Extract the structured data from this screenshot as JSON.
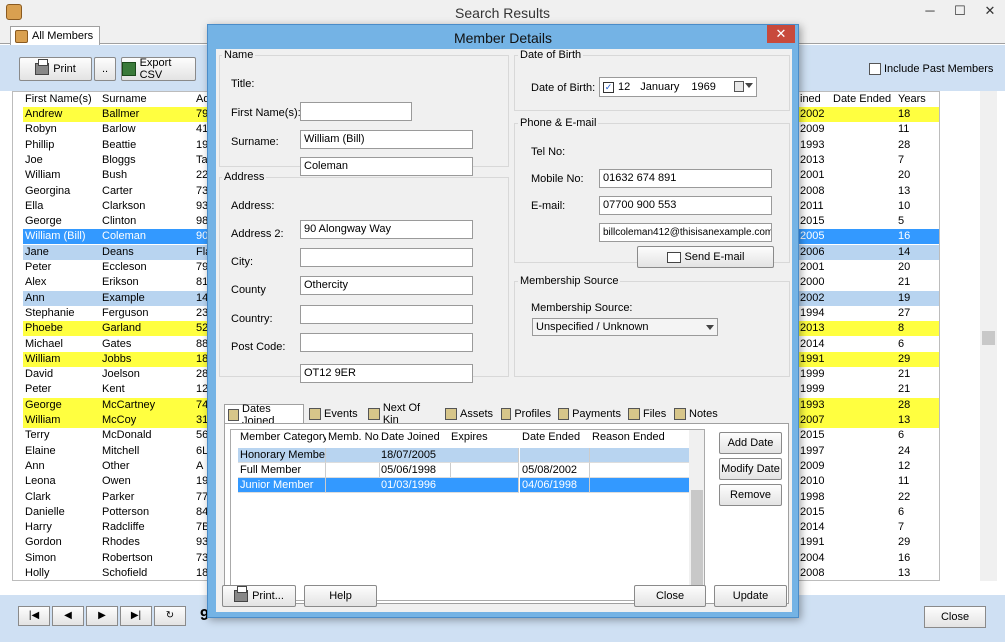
{
  "window": {
    "title": "Search Results",
    "minimize": "─",
    "maximize": "☐",
    "close": "✕"
  },
  "main_tab": {
    "label": "All Members"
  },
  "toolbar": {
    "print_label": "Print",
    "more_label": "..",
    "export_label": "Export CSV",
    "include_past_label": "Include Past Members"
  },
  "grid": {
    "headers": {
      "first": "First Name(s)",
      "surname": "Surname",
      "address": "Ad",
      "joined": "ined",
      "ended": "Date Ended",
      "years": "Years"
    },
    "rows": [
      {
        "first": "Andrew",
        "surname": "Ballmer",
        "address": "79",
        "joined": "2002",
        "ended": "",
        "years": "18",
        "style": "yellow"
      },
      {
        "first": "Robyn",
        "surname": "Barlow",
        "address": "41",
        "joined": "2009",
        "ended": "",
        "years": "11",
        "style": ""
      },
      {
        "first": "Phillip",
        "surname": "Beattie",
        "address": "19",
        "joined": "1993",
        "ended": "",
        "years": "28",
        "style": ""
      },
      {
        "first": "Joe",
        "surname": "Bloggs",
        "address": "Ta",
        "joined": "2013",
        "ended": "",
        "years": "7",
        "style": ""
      },
      {
        "first": "William",
        "surname": "Bush",
        "address": "22",
        "joined": "2001",
        "ended": "",
        "years": "20",
        "style": ""
      },
      {
        "first": "Georgina",
        "surname": "Carter",
        "address": "73",
        "joined": "2008",
        "ended": "",
        "years": "13",
        "style": ""
      },
      {
        "first": "Ella",
        "surname": "Clarkson",
        "address": "93",
        "joined": "2011",
        "ended": "",
        "years": "10",
        "style": ""
      },
      {
        "first": "George",
        "surname": "Clinton",
        "address": "98",
        "joined": "2015",
        "ended": "",
        "years": "5",
        "style": ""
      },
      {
        "first": "William (Bill)",
        "surname": "Coleman",
        "address": "90",
        "joined": "2005",
        "ended": "",
        "years": "16",
        "style": "selected"
      },
      {
        "first": "Jane",
        "surname": "Deans",
        "address": "Fla",
        "joined": "2006",
        "ended": "",
        "years": "14",
        "style": "alt"
      },
      {
        "first": "Peter",
        "surname": "Eccleson",
        "address": "79",
        "joined": "2001",
        "ended": "",
        "years": "20",
        "style": ""
      },
      {
        "first": "Alex",
        "surname": "Erikson",
        "address": "81",
        "joined": "2000",
        "ended": "",
        "years": "21",
        "style": ""
      },
      {
        "first": "Ann",
        "surname": "Example",
        "address": "14",
        "joined": "2002",
        "ended": "",
        "years": "19",
        "style": "alt"
      },
      {
        "first": "Stephanie",
        "surname": "Ferguson",
        "address": "23",
        "joined": "1994",
        "ended": "",
        "years": "27",
        "style": ""
      },
      {
        "first": "Phoebe",
        "surname": "Garland",
        "address": "52",
        "joined": "2013",
        "ended": "",
        "years": "8",
        "style": "yellow"
      },
      {
        "first": "Michael",
        "surname": "Gates",
        "address": "88",
        "joined": "2014",
        "ended": "",
        "years": "6",
        "style": ""
      },
      {
        "first": "William",
        "surname": "Jobbs",
        "address": "18",
        "joined": "1991",
        "ended": "",
        "years": "29",
        "style": "yellow"
      },
      {
        "first": "David",
        "surname": "Joelson",
        "address": "28",
        "joined": "1999",
        "ended": "",
        "years": "21",
        "style": ""
      },
      {
        "first": "Peter",
        "surname": "Kent",
        "address": "12",
        "joined": "1999",
        "ended": "",
        "years": "21",
        "style": ""
      },
      {
        "first": "George",
        "surname": "McCartney",
        "address": "74",
        "joined": "1993",
        "ended": "",
        "years": "28",
        "style": "yellow"
      },
      {
        "first": "William",
        "surname": "McCoy",
        "address": "31",
        "joined": "2007",
        "ended": "",
        "years": "13",
        "style": "yellow"
      },
      {
        "first": "Terry",
        "surname": "McDonald",
        "address": "56",
        "joined": "2015",
        "ended": "",
        "years": "6",
        "style": ""
      },
      {
        "first": "Elaine",
        "surname": "Mitchell",
        "address": "6L",
        "joined": "1997",
        "ended": "",
        "years": "24",
        "style": ""
      },
      {
        "first": "Ann",
        "surname": "Other",
        "address": "A",
        "joined": "2009",
        "ended": "",
        "years": "12",
        "style": ""
      },
      {
        "first": "Leona",
        "surname": "Owen",
        "address": "19",
        "joined": "2010",
        "ended": "",
        "years": "11",
        "style": ""
      },
      {
        "first": "Clark",
        "surname": "Parker",
        "address": "77",
        "joined": "1998",
        "ended": "",
        "years": "22",
        "style": ""
      },
      {
        "first": "Danielle",
        "surname": "Potterson",
        "address": "84",
        "joined": "2015",
        "ended": "",
        "years": "6",
        "style": ""
      },
      {
        "first": "Harry",
        "surname": "Radcliffe",
        "address": "7B",
        "joined": "2014",
        "ended": "",
        "years": "7",
        "style": ""
      },
      {
        "first": "Gordon",
        "surname": "Rhodes",
        "address": "93",
        "joined": "1991",
        "ended": "",
        "years": "29",
        "style": ""
      },
      {
        "first": "Simon",
        "surname": "Robertson",
        "address": "73",
        "joined": "2004",
        "ended": "",
        "years": "16",
        "style": ""
      },
      {
        "first": "Holly",
        "surname": "Schofield",
        "address": "18",
        "joined": "2008",
        "ended": "",
        "years": "13",
        "style": ""
      }
    ]
  },
  "navigation": {
    "first": "|◀",
    "prev": "◀",
    "next": "▶",
    "last": "▶|",
    "refresh": "↻"
  },
  "count_text": "9",
  "close_main_label": "Close",
  "dialog": {
    "title": "Member Details",
    "close": "✕",
    "name_group": "Name",
    "title_label": "Title:",
    "title_value": "",
    "first_label": "First Name(s):",
    "first_value": "William (Bill)",
    "surname_label": "Surname:",
    "surname_value": "Coleman",
    "address_group": "Address",
    "address_label": "Address:",
    "address_value": "90 Alongway Way",
    "address2_label": "Address 2:",
    "address2_value": "",
    "city_label": "City:",
    "city_value": "Othercity",
    "county_label": "County",
    "county_value": "",
    "country_label": "Country:",
    "country_value": "",
    "postcode_label": "Post Code:",
    "postcode_value": "OT12 9ER",
    "dob_group": "Date of Birth",
    "dob_label": "Date of Birth:",
    "dob_day": "12",
    "dob_month": "January",
    "dob_year": "1969",
    "phone_group": "Phone & E-mail",
    "tel_label": "Tel No:",
    "tel_value": "01632 674 891",
    "mobile_label": "Mobile No:",
    "mobile_value": "07700 900 553",
    "email_label": "E-mail:",
    "email_value": "billcoleman412@thisisanexample.com",
    "send_email_label": "Send E-mail",
    "source_group": "Membership Source",
    "source_label": "Membership Source:",
    "source_value": "Unspecified / Unknown",
    "tabs": [
      "Dates Joined",
      "Events",
      "Next Of Kin",
      "Assets",
      "Profiles",
      "Payments",
      "Files",
      "Notes"
    ],
    "dates_headers": {
      "category": "Member Category",
      "memb": "Memb. No.",
      "joined": "Date Joined",
      "expires": "Expires",
      "ended": "Date Ended",
      "reason": "Reason Ended"
    },
    "dates_rows": [
      {
        "category": "Honorary Member",
        "memb": "",
        "joined": "18/07/2005",
        "expires": "",
        "ended": "",
        "reason": "",
        "style": "alt"
      },
      {
        "category": "Full Member",
        "memb": "",
        "joined": "05/06/1998",
        "expires": "",
        "ended": "05/08/2002",
        "reason": "",
        "style": ""
      },
      {
        "category": "Junior Member",
        "memb": "",
        "joined": "01/03/1996",
        "expires": "",
        "ended": "04/06/1998",
        "reason": "",
        "style": "selected"
      }
    ],
    "add_date_label": "Add Date",
    "modify_date_label": "Modify Date",
    "remove_label": "Remove",
    "print_label": "Print...",
    "help_label": "Help",
    "close_label": "Close",
    "update_label": "Update"
  }
}
